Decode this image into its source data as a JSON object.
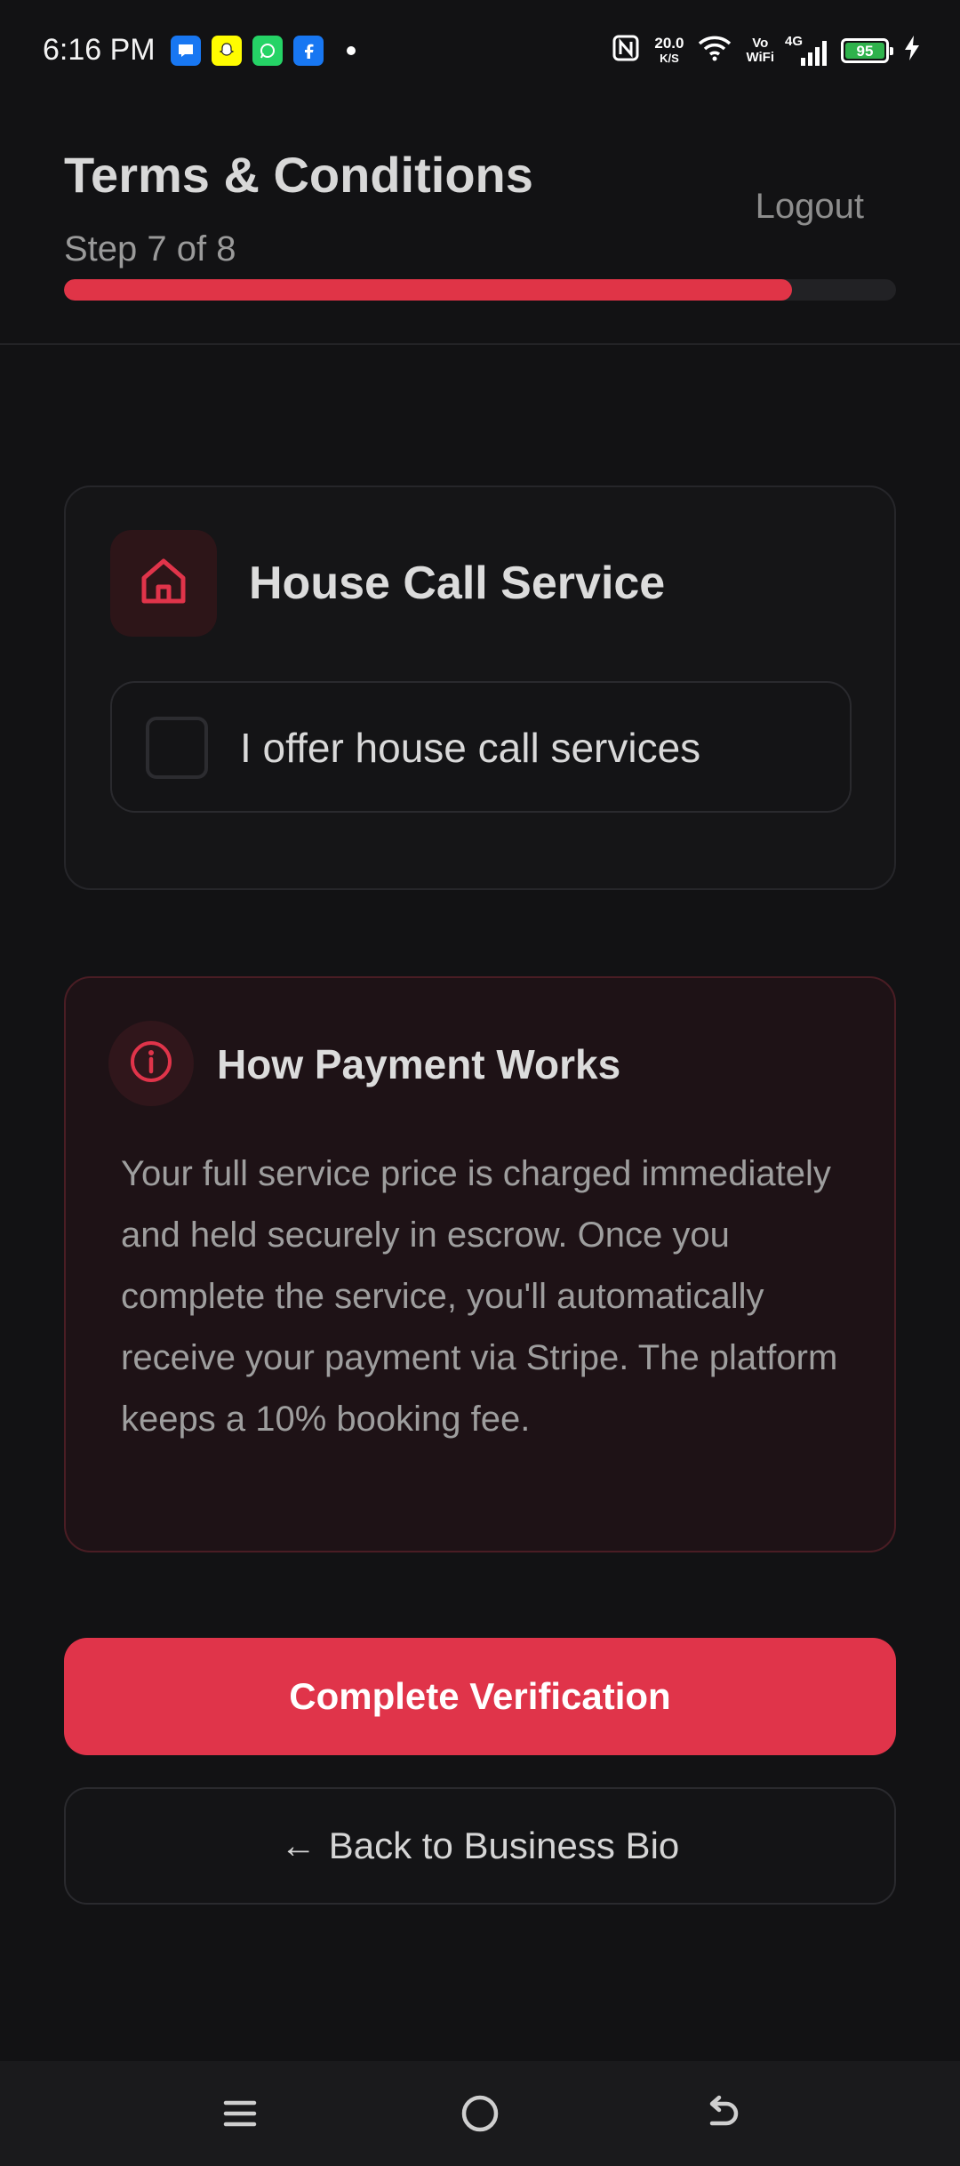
{
  "status_bar": {
    "time": "6:16 PM",
    "network_speed": "20.0",
    "network_speed_unit": "K/S",
    "vowifi_top": "Vo",
    "vowifi_bottom": "WiFi",
    "signal_type": "4G",
    "battery_level": "95",
    "battery_percent": 95
  },
  "header": {
    "title": "Terms & Conditions",
    "step_label": "Step 7 of 8",
    "logout_label": "Logout",
    "progress_fraction": 0.875
  },
  "house_call": {
    "title": "House Call Service",
    "checkbox_label": "I offer house call services",
    "checked": false
  },
  "payment_info": {
    "title": "How Payment Works",
    "body": "Your full service price is charged immediately and held securely in escrow. Once you complete the service, you'll automatically receive your payment via Stripe. The platform keeps a 10% booking fee."
  },
  "actions": {
    "primary_label": "Complete Verification",
    "secondary_arrow": "←",
    "secondary_label": "Back to Business Bio"
  },
  "nav": {
    "items": [
      "menu-icon",
      "home-icon",
      "back-icon"
    ]
  },
  "colors": {
    "accent": "#e0344a",
    "background": "#121214"
  }
}
